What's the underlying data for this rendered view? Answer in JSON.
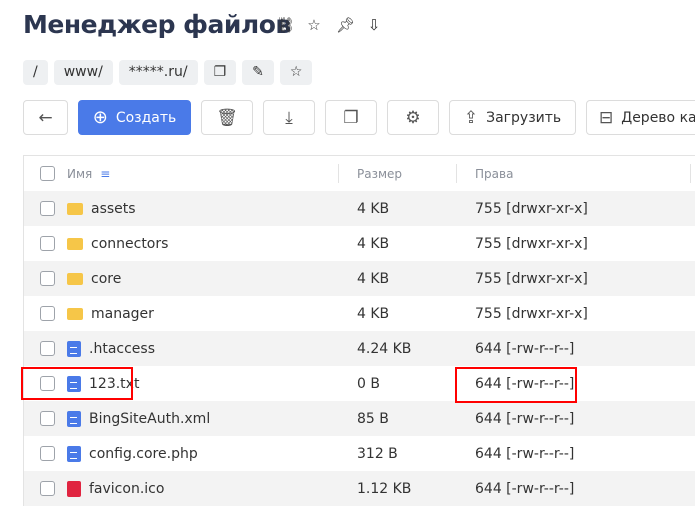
{
  "header": {
    "title": "Менеджер файлов",
    "icons": [
      "link-icon",
      "star-icon",
      "pin-icon",
      "download-doc-icon"
    ]
  },
  "breadcrumb": [
    "/",
    "www/",
    "*****.ru/"
  ],
  "breadcrumb_icons": [
    "copy-icon",
    "pencil-icon",
    "folder-star-icon"
  ],
  "toolbar": {
    "create": "Создать",
    "upload": "Загрузить",
    "tree": "Дерево ка"
  },
  "table": {
    "columns": {
      "name": "Имя",
      "size": "Размер",
      "perms": "Права"
    },
    "rows": [
      {
        "name": "assets",
        "type": "folder",
        "size": "4 KB",
        "perms": "755 [drwxr-xr-x]"
      },
      {
        "name": "connectors",
        "type": "folder",
        "size": "4 KB",
        "perms": "755 [drwxr-xr-x]"
      },
      {
        "name": "core",
        "type": "folder",
        "size": "4 KB",
        "perms": "755 [drwxr-xr-x]"
      },
      {
        "name": "manager",
        "type": "folder",
        "size": "4 KB",
        "perms": "755 [drwxr-xr-x]"
      },
      {
        "name": ".htaccess",
        "type": "doc",
        "size": "4.24 KB",
        "perms": "644 [-rw-r--r--]"
      },
      {
        "name": "123.txt",
        "type": "doc",
        "size": "0 B",
        "perms": "644 [-rw-r--r--]"
      },
      {
        "name": "BingSiteAuth.xml",
        "type": "doc",
        "size": "85 B",
        "perms": "644 [-rw-r--r--]"
      },
      {
        "name": "config.core.php",
        "type": "doc",
        "size": "312 B",
        "perms": "644 [-rw-r--r--]"
      },
      {
        "name": "favicon.ico",
        "type": "img",
        "size": "1.12 KB",
        "perms": "644 [-rw-r--r--]"
      }
    ]
  },
  "colors": {
    "accent": "#4a7ae8",
    "highlight": "#ff0000",
    "folder": "#f6c648"
  }
}
